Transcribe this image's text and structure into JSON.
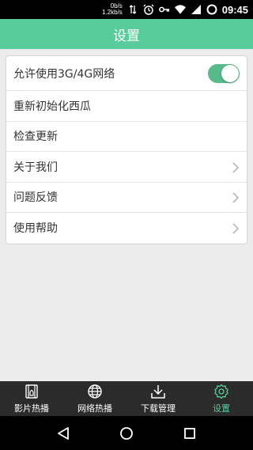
{
  "status_bar": {
    "net_down": "0b/s",
    "net_up": "1.2kb/s",
    "time": "09:45",
    "icons": [
      "data-transfer-icon",
      "alarm-icon",
      "key-icon",
      "wifi-icon",
      "signal-icon",
      "circle-status-icon"
    ]
  },
  "app_bar": {
    "title": "设置"
  },
  "settings": {
    "rows": [
      {
        "label": "允许使用3G/4G网络",
        "control": "toggle",
        "toggle_on": true
      },
      {
        "label": "重新初始化西瓜",
        "control": "none"
      },
      {
        "label": "检查更新",
        "control": "none"
      },
      {
        "label": "关于我们",
        "control": "chevron-right-icon"
      },
      {
        "label": "问题反馈",
        "control": "chevron-right-icon"
      },
      {
        "label": "使用帮助",
        "control": "chevron-right-icon"
      }
    ]
  },
  "tab_bar": {
    "tabs": [
      {
        "label": "影片热播",
        "icon": "film-icon",
        "active": false
      },
      {
        "label": "网络热播",
        "icon": "globe-icon",
        "active": false
      },
      {
        "label": "下载管理",
        "icon": "download-icon",
        "active": false
      },
      {
        "label": "设置",
        "icon": "gear-icon",
        "active": true
      }
    ]
  },
  "nav_bar": {
    "buttons": [
      "back-icon",
      "home-icon",
      "recents-icon"
    ]
  },
  "colors": {
    "accent": "#58cc9a",
    "toggle_on": "#58b98a",
    "tab_bg": "#2b2b2b",
    "page_bg": "#ececec"
  }
}
